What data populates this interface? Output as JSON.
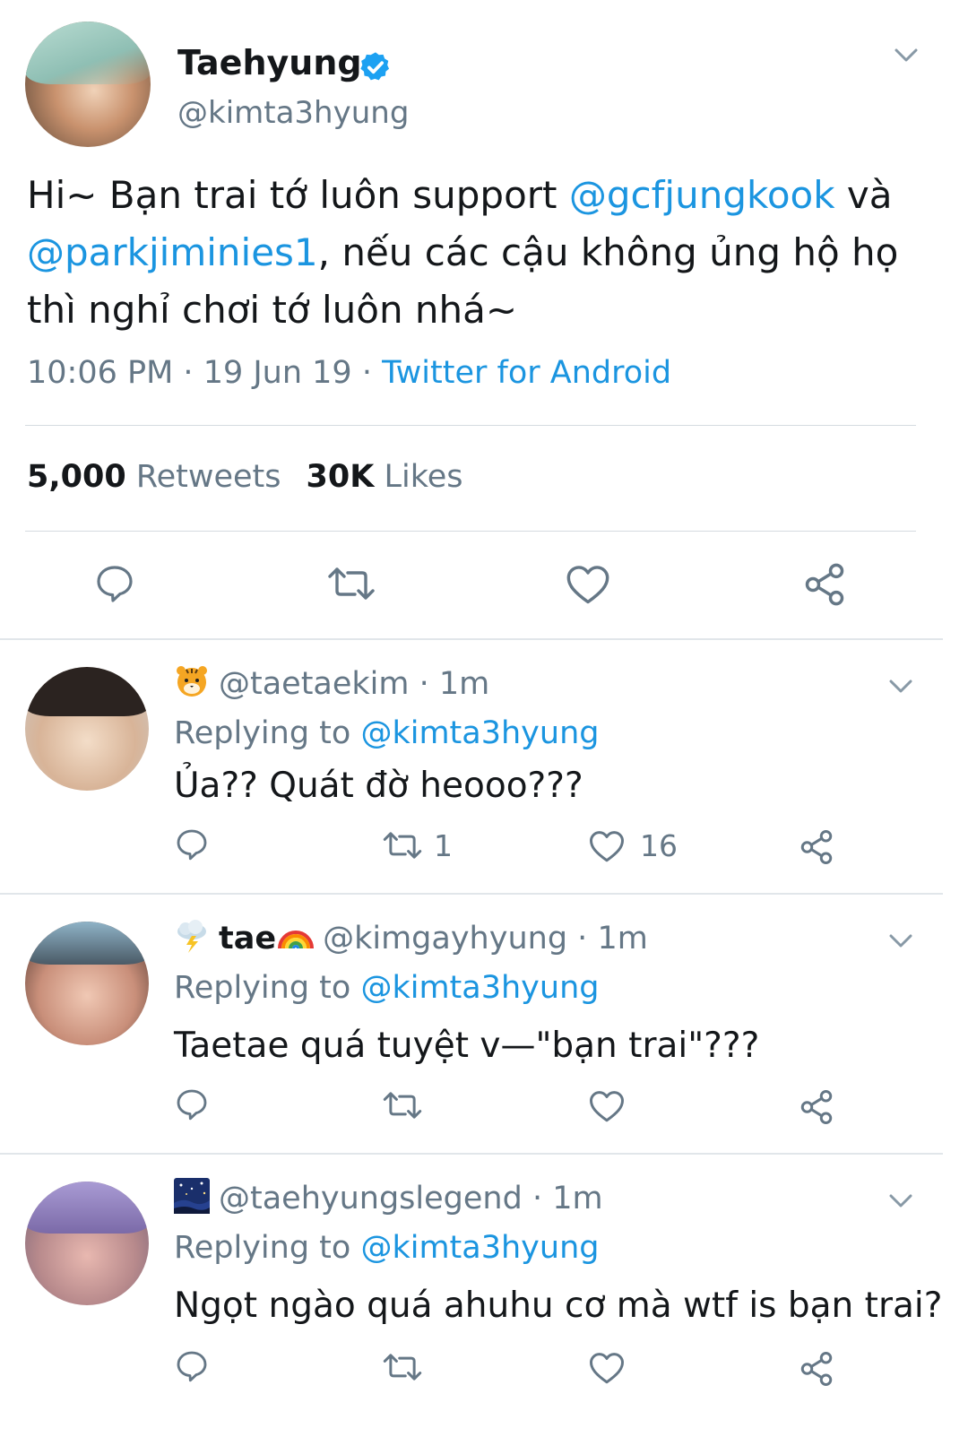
{
  "main_tweet": {
    "display_name": "Taehyung",
    "handle": "@kimta3hyung",
    "text_parts": {
      "p1": "Hi~ Bạn trai tớ luôn support ",
      "m1": "@gcfjungkook",
      "p2": " và ",
      "m2": "@parkjiminies1",
      "p3": ", nếu các cậu không ủng hộ họ thì nghỉ chơi tớ luôn nhá~"
    },
    "time": "10:06 PM",
    "date": "19 Jun 19",
    "source": "Twitter for Android",
    "separator": " · ",
    "retweets_count": "5,000",
    "retweets_label": "Retweets",
    "likes_count": "30K",
    "likes_label": "Likes"
  },
  "replies": [
    {
      "emoji": "tiger-emoji",
      "name": "",
      "handle": "@taetaekim",
      "time": "1m",
      "replying_label": "Replying to",
      "replying_to": "@kimta3hyung",
      "text": "Ủa?? Quát đờ heooo???",
      "retweet_count": "1",
      "like_count": "16"
    },
    {
      "emoji": "cloud-lightning-emoji",
      "name": "tae",
      "handle": "@kimgayhyung",
      "time": "1m",
      "replying_label": "Replying to",
      "replying_to": "@kimta3hyung",
      "text": "Taetae quá tuyệt v—\"bạn trai\"???",
      "retweet_count": "",
      "like_count": ""
    },
    {
      "emoji": "night-sky-emoji",
      "name": "",
      "handle": "@taehyungslegend",
      "time": "1m",
      "replying_label": "Replying to",
      "replying_to": "@kimta3hyung",
      "text": "Ngọt ngào quá ahuhu cơ mà wtf is bạn trai?",
      "retweet_count": "",
      "like_count": ""
    }
  ],
  "colors": {
    "link": "#1b95e0",
    "muted": "#657786",
    "text": "#14171a",
    "verified": "#1da1f2"
  }
}
